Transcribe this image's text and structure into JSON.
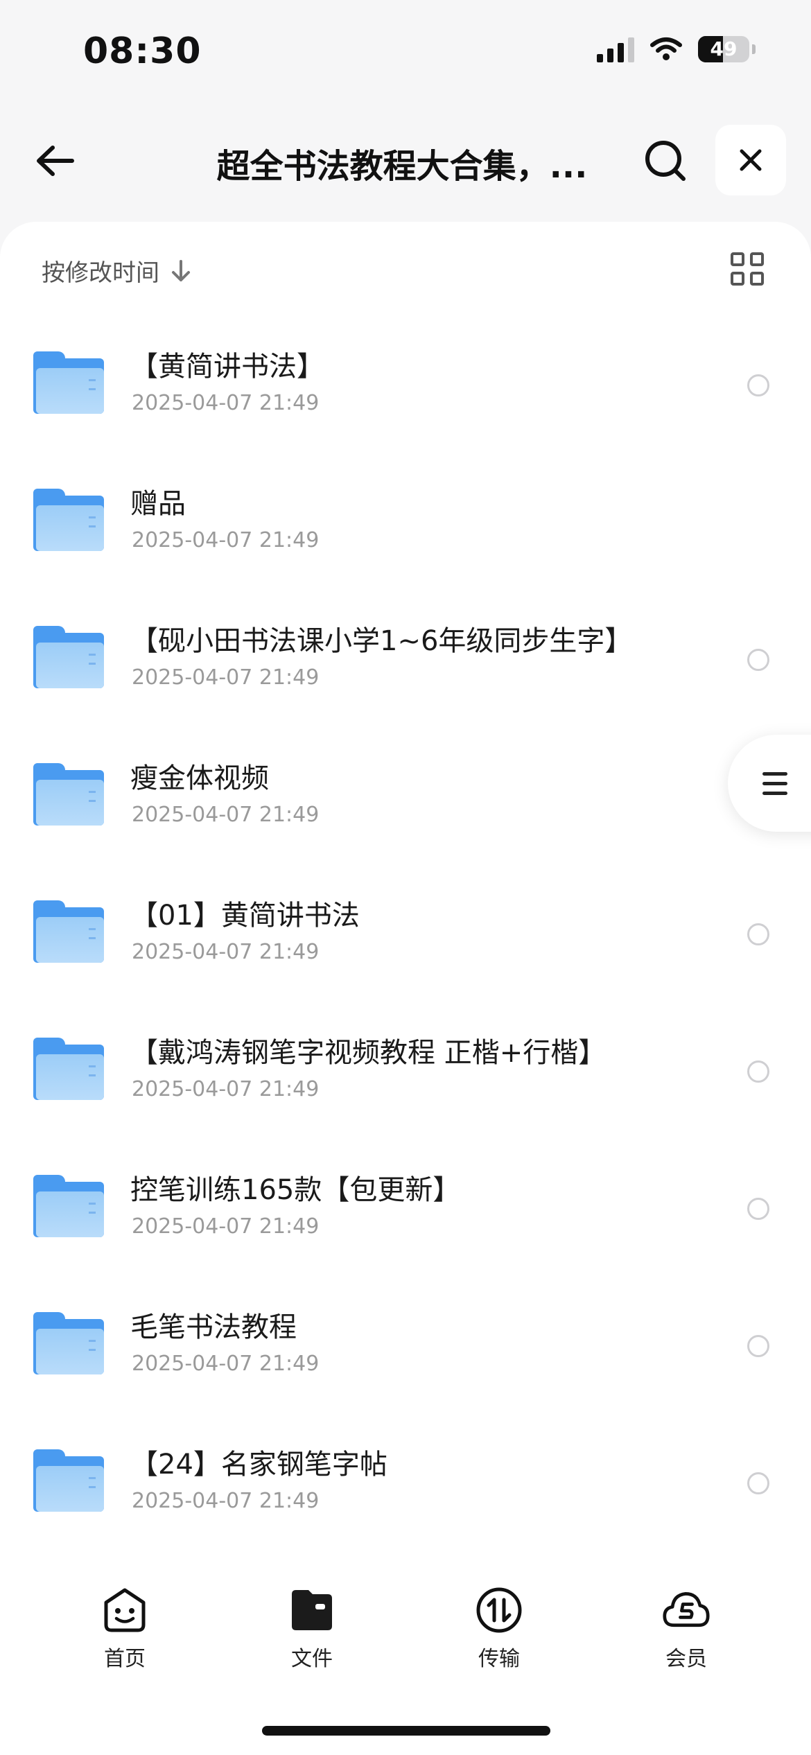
{
  "status_bar": {
    "time": "08:30",
    "battery": "49",
    "battery_level": 0.49,
    "icons": [
      "signal-icon",
      "wifi-icon",
      "battery-icon"
    ]
  },
  "nav": {
    "title": "超全书法教程大合集，...",
    "icons": {
      "back": "back-arrow-icon",
      "search": "search-icon",
      "close": "close-icon"
    }
  },
  "toolbar": {
    "sort_label": "按修改时间",
    "sort_icon": "arrow-down-icon",
    "view_icon": "grid-view-icon"
  },
  "files": [
    {
      "name": "【黄简讲书法】",
      "date": "2025-04-07 21:49",
      "icon": "folder-icon"
    },
    {
      "name": "赠品",
      "date": "2025-04-07 21:49",
      "icon": "folder-icon"
    },
    {
      "name": "【砚小田书法课小学1~6年级同步生字】",
      "date": "2025-04-07 21:49",
      "icon": "folder-icon"
    },
    {
      "name": "瘦金体视频",
      "date": "2025-04-07 21:49",
      "icon": "folder-icon"
    },
    {
      "name": "【01】黄简讲书法",
      "date": "2025-04-07 21:49",
      "icon": "folder-icon"
    },
    {
      "name": "【戴鸿涛钢笔字视频教程  正楷+行楷】",
      "date": "2025-04-07 21:49",
      "icon": "folder-icon"
    },
    {
      "name": "控笔训练165款【包更新】",
      "date": "2025-04-07 21:49",
      "icon": "folder-icon"
    },
    {
      "name": "毛笔书法教程",
      "date": "2025-04-07 21:49",
      "icon": "folder-icon"
    },
    {
      "name": "【24】名家钢笔字帖",
      "date": "2025-04-07 21:49",
      "icon": "folder-icon"
    }
  ],
  "floating_menu": {
    "icon": "menu-icon"
  },
  "tab_bar": {
    "items": [
      {
        "label": "首页",
        "icon": "smiley-home-icon"
      },
      {
        "label": "文件",
        "icon": "folder-tab-icon"
      },
      {
        "label": "传输",
        "icon": "transfer-icon"
      },
      {
        "label": "会员",
        "icon": "cloud-vip-icon"
      }
    ],
    "active_index": 1
  },
  "colors": {
    "accent": "#4a9bf0",
    "background": "#f6f6f7",
    "text_primary": "#1a1a1a",
    "text_secondary": "#9a9a9a"
  }
}
